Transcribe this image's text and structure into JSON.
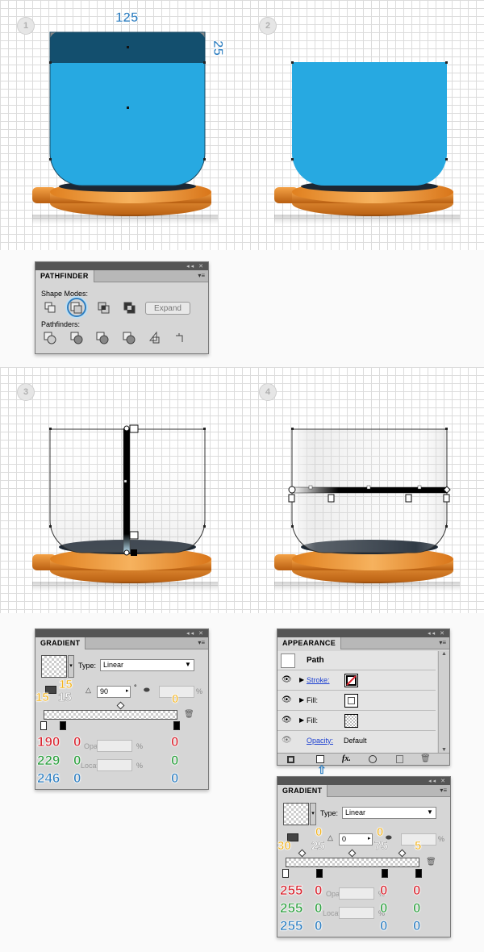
{
  "steps": [
    "1",
    "2",
    "3",
    "4"
  ],
  "dimensions": {
    "width_label": "125",
    "height_label": "25"
  },
  "pathfinder": {
    "tab": "PATHFINDER",
    "shape_modes_label": "Shape Modes:",
    "pathfinders_label": "Pathfinders:",
    "expand_label": "Expand",
    "shape_mode_icons": [
      "unite-icon",
      "minus-front-icon",
      "intersect-icon",
      "exclude-icon"
    ],
    "pathfinder_icons": [
      "divide-icon",
      "trim-icon",
      "merge-icon",
      "crop-icon",
      "outline-icon",
      "minus-back-icon"
    ]
  },
  "gradient1": {
    "tab": "GRADIENT",
    "type_label": "Type:",
    "type_value": "Linear",
    "angle_value": "90",
    "angle_unit": "°",
    "percent_sign": "%",
    "opacity_label": "Opacity:",
    "location_label": "Location:",
    "annotation_15_yellow_a": "15",
    "annotation_15_yellow_b": "15",
    "annotation_15_white": "15",
    "annotation_0_right": "0",
    "rgb_left": {
      "r": "190",
      "g": "229",
      "b": "246",
      "r0": "0",
      "g0": "0",
      "b0": "0"
    },
    "rgb_right": {
      "r": "0",
      "g": "0",
      "b": "0"
    }
  },
  "appearance": {
    "tab": "APPEARANCE",
    "title": "Path",
    "rows": [
      {
        "label": "Stroke:",
        "link": true
      },
      {
        "label": "Fill:",
        "link": false
      },
      {
        "label": "Fill:",
        "link": false
      }
    ],
    "opacity_label": "Opacity:",
    "opacity_value": "Default",
    "footer_icons": [
      "add-stroke-icon",
      "add-fill-icon",
      "fx-icon",
      "clear-icon",
      "duplicate-icon",
      "delete-icon"
    ],
    "fx_label": "fx."
  },
  "gradient2": {
    "tab": "GRADIENT",
    "type_label": "Type:",
    "type_value": "Linear",
    "angle_value": "0",
    "percent_sign": "%",
    "opacity_label": "Opacity:",
    "location_label": "Location:",
    "annot_30": "30",
    "annot_0a": "0",
    "annot_25": "25",
    "annot_0b": "0",
    "annot_75": "75",
    "annot_5": "5",
    "rgb_left": {
      "r": "255",
      "g": "255",
      "b": "255",
      "r0": "0",
      "g0": "0",
      "b0": "0"
    },
    "rgb_mid": {
      "r": "0",
      "g": "0",
      "b": "0"
    },
    "rgb_right": {
      "r": "0",
      "g": "0",
      "b": "0"
    }
  },
  "colors": {
    "cup_blue": "#27a9e1",
    "dark_blue": "#134f6e",
    "plate_orange": "#e8862a",
    "annotation_blue": "#2f7fc1"
  }
}
